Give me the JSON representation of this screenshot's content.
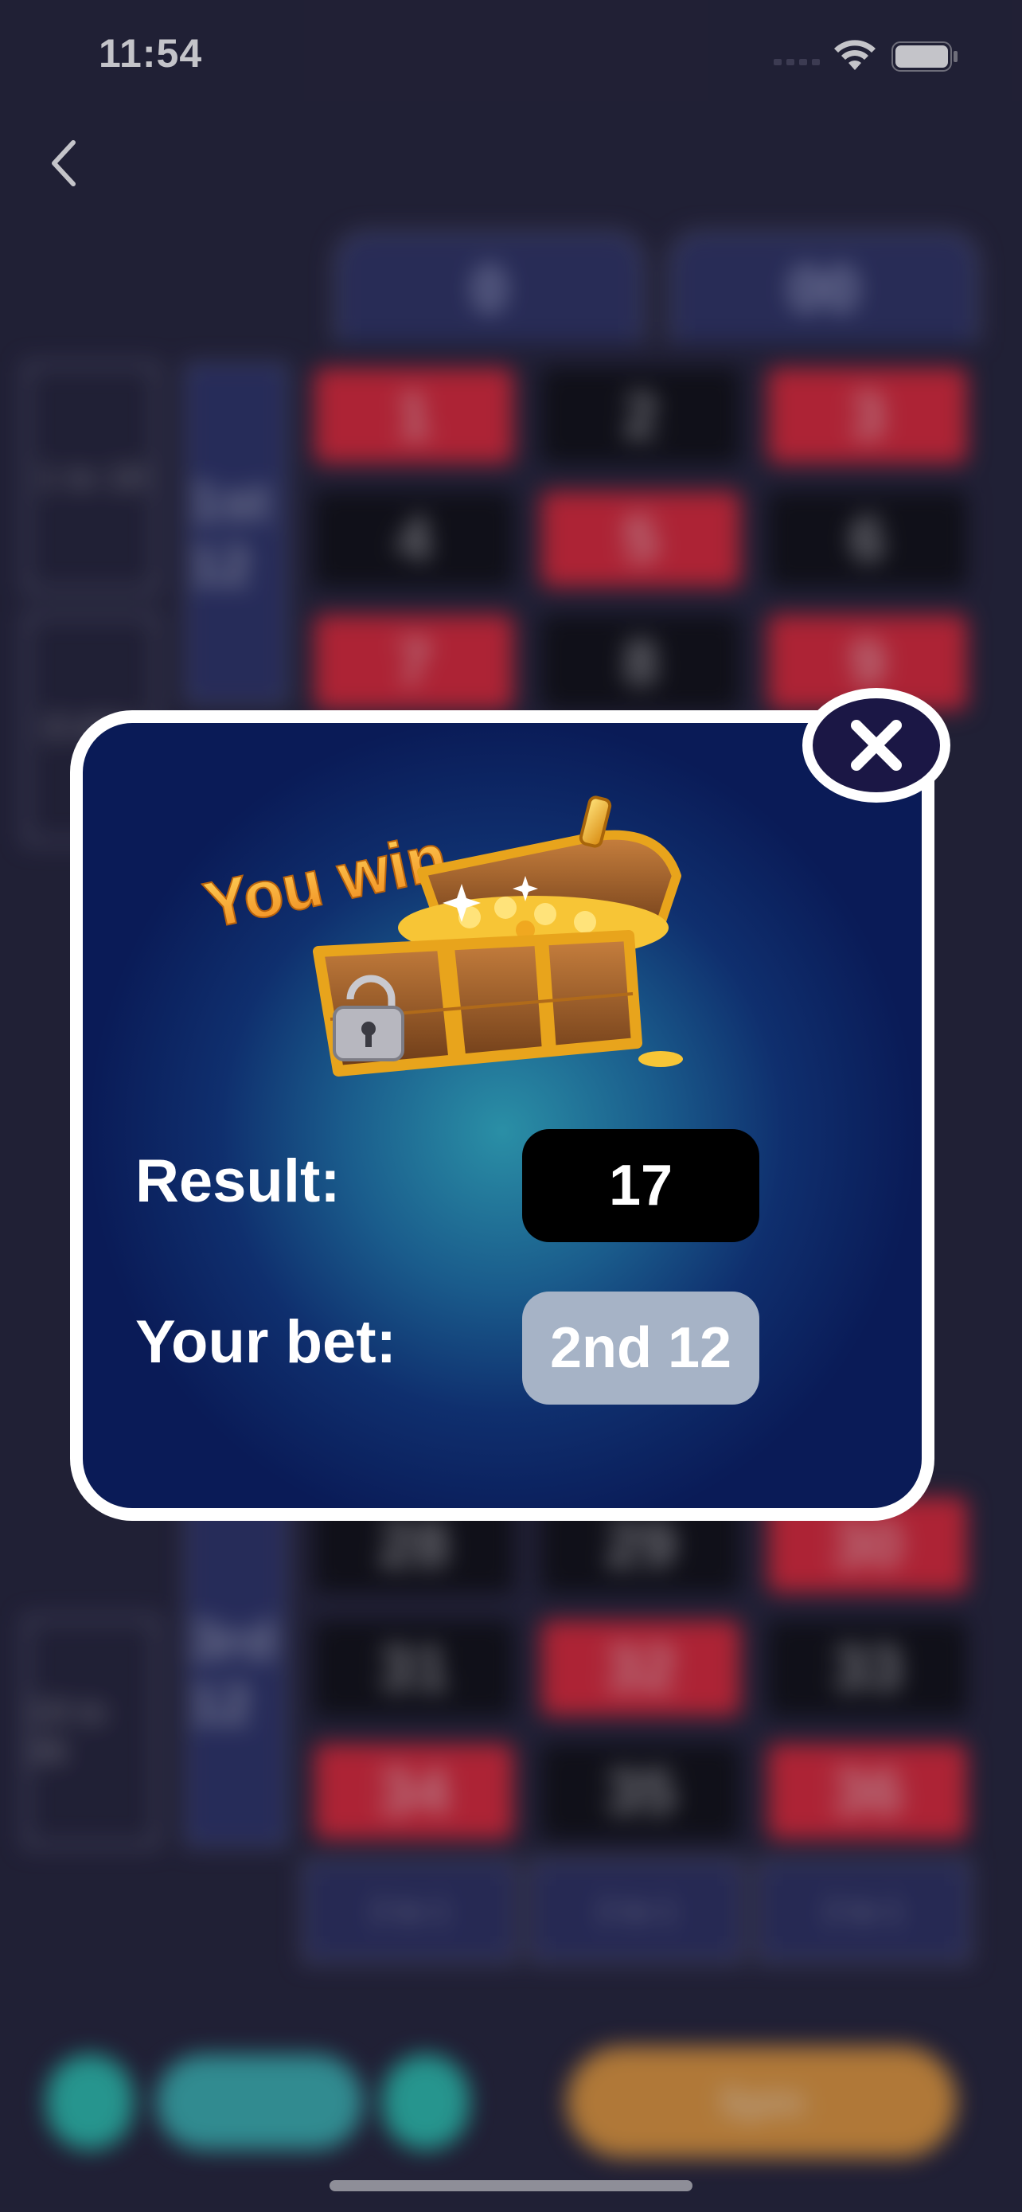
{
  "status_bar": {
    "time": "11:54"
  },
  "board": {
    "zero_labels": [
      "0",
      "00"
    ],
    "rows": [
      [
        {
          "n": "1",
          "c": "red"
        },
        {
          "n": "2",
          "c": "black"
        },
        {
          "n": "3",
          "c": "red"
        }
      ],
      [
        {
          "n": "4",
          "c": "black"
        },
        {
          "n": "5",
          "c": "red"
        },
        {
          "n": "6",
          "c": "black"
        }
      ],
      [
        {
          "n": "7",
          "c": "red"
        },
        {
          "n": "8",
          "c": "black"
        },
        {
          "n": "9",
          "c": "red"
        }
      ]
    ],
    "bottom_rows": [
      [
        {
          "n": "28",
          "c": "black"
        },
        {
          "n": "29",
          "c": "black"
        },
        {
          "n": "30",
          "c": "red"
        }
      ],
      [
        {
          "n": "31",
          "c": "black"
        },
        {
          "n": "32",
          "c": "red"
        },
        {
          "n": "33",
          "c": "black"
        }
      ],
      [
        {
          "n": "34",
          "c": "red"
        },
        {
          "n": "35",
          "c": "black"
        },
        {
          "n": "36",
          "c": "red"
        }
      ]
    ],
    "dozen_labels": [
      "1st 12",
      "3rd 12"
    ],
    "side_labels": [
      "1 to 18",
      "EVEN",
      "19 to 36"
    ],
    "column_bets": [
      "2 to 1",
      "2 to 1",
      "2 to 1"
    ],
    "chips": [
      "",
      "",
      ""
    ],
    "spin_label": "Spin"
  },
  "popup": {
    "title": "You win",
    "result_label": "Result:",
    "result_value": "17",
    "bet_label": "Your bet:",
    "bet_value": "2nd 12"
  },
  "colors": {
    "red": "#e0293a",
    "black": "#0f0f14",
    "popup_bg": "#0f2f6e",
    "bet_pill": "#a6b3c6",
    "title_gold": "#f5a623"
  },
  "icons": {
    "back": "chevron-left-icon",
    "close": "close-icon",
    "wifi": "wifi-icon",
    "battery": "battery-icon",
    "chest": "treasure-chest-icon"
  }
}
